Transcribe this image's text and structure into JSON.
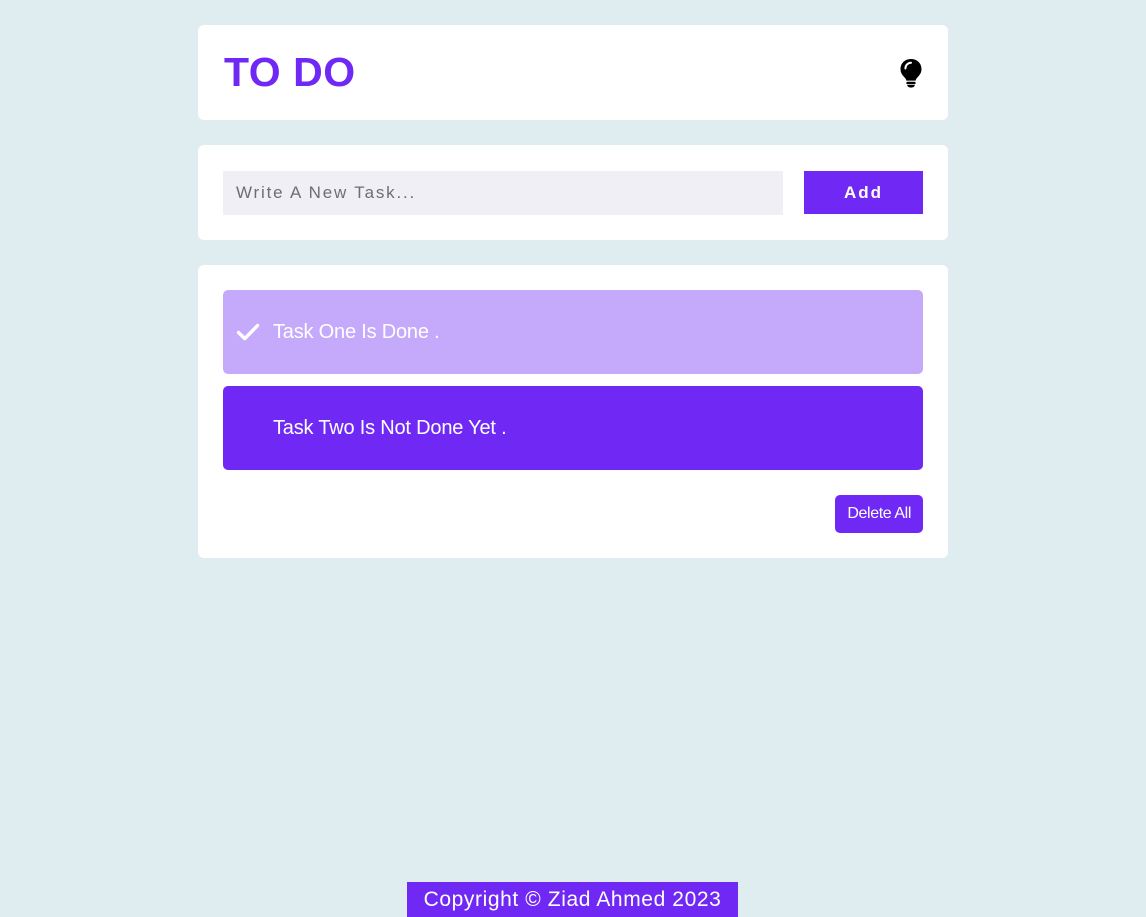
{
  "app": {
    "title": "TO DO",
    "theme_icon": "lightbulb-icon"
  },
  "form": {
    "placeholder": "Write A New Task...",
    "value": "",
    "add_label": "Add"
  },
  "tasks": [
    {
      "text": "Task One Is Done .",
      "done": true,
      "icon": "check-icon"
    },
    {
      "text": "Task Two Is Not Done Yet .",
      "done": false
    }
  ],
  "actions": {
    "delete_all_label": "Delete All"
  },
  "footer": {
    "text": "Copyright © Ziad Ahmed 2023"
  },
  "colors": {
    "background": "#dfedf1",
    "accent": "#7029f5",
    "done_task": "#c5aafb",
    "input_bg": "#f1eff6",
    "card": "#ffffff"
  }
}
